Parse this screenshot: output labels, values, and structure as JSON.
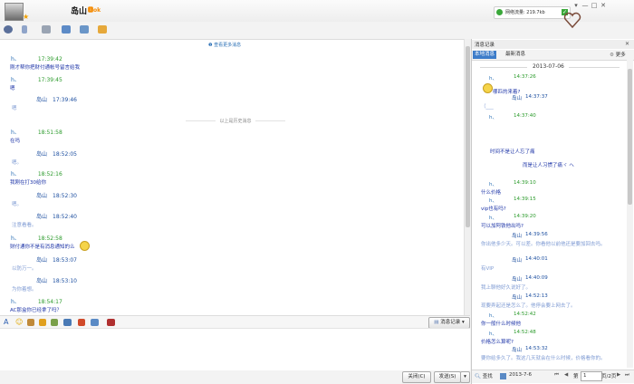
{
  "header": {
    "contact_name": "岛山",
    "name_badge": "🅰ok",
    "traffic_label": "网络流量: 219.7kb",
    "window_controls": [
      "▾",
      "—",
      "□",
      "✕"
    ]
  },
  "toolbar": {
    "icons": [
      "status-icon",
      "mic-icon",
      "folder-icon",
      "screen-share-icon",
      "remote-assist-icon",
      "apps-icon"
    ]
  },
  "chat": {
    "history_link": "查看更多消息",
    "history_divider": "以上是历史消息",
    "messages": [
      {
        "sender": "h、",
        "time": "17:39:42",
        "body": "刚才帮你把财付通帐号留言给我",
        "mine": true
      },
      {
        "sender": "h、",
        "time": "17:39:45",
        "body": "嗯",
        "mine": true
      },
      {
        "sender": "岛山",
        "time": "17:39:46",
        "body": "嗯",
        "mine": false
      },
      {
        "sender": "h、",
        "time": "18:51:58",
        "body": "在吗",
        "mine": true
      },
      {
        "sender": "岛山",
        "time": "18:52:05",
        "body": "嗯。",
        "mine": false
      },
      {
        "sender": "h、",
        "time": "18:52:16",
        "body": "我刚在打30给你",
        "mine": true
      },
      {
        "sender": "岛山",
        "time": "18:52:30",
        "body": "嗯。",
        "mine": false
      },
      {
        "sender": "岛山",
        "time": "18:52:40",
        "body": "注意看看。",
        "mine": false
      },
      {
        "sender": "h、",
        "time": "18:52:58",
        "body": "财付通你不是有消息通知的么",
        "mine": true
      },
      {
        "sender": "岛山",
        "time": "18:53:07",
        "body": "以防万一。",
        "mine": false
      },
      {
        "sender": "岛山",
        "time": "18:53:10",
        "body": "为你着想。",
        "mine": false
      },
      {
        "sender": "h、",
        "time": "18:54:17",
        "body": "AC那盒你已经拿了吗？",
        "mine": true
      }
    ]
  },
  "input": {
    "history_button": "消息记录",
    "close_button": "关闭(C)",
    "send_button": "发送(S)"
  },
  "history_panel": {
    "title": "消息记录",
    "tab_local": "本地消息",
    "tab_recent": "最新消息",
    "more": "更多",
    "date": "2013-07-06",
    "entries": [
      {
        "sender": "h、",
        "time": "14:37:26",
        "body": "哪匹的来着?",
        "mine": true
      },
      {
        "sender": "岛山",
        "time": "14:37:37",
        "body": "（___",
        "mine": false
      },
      {
        "sender": "h、",
        "time": "14:37:40",
        "body": "",
        "mine": true
      },
      {
        "sender": "",
        "time": "",
        "body": "时间不是让人忘了痛",
        "mine": true
      },
      {
        "sender": "",
        "time": "",
        "body": "而是让人习惯了痛ヾ ヘ",
        "mine": true
      },
      {
        "sender": "h、",
        "time": "14:39:10",
        "body": "什么价格",
        "mine": true
      },
      {
        "sender": "h、",
        "time": "14:39:15",
        "body": "vip也有吗?",
        "mine": true
      },
      {
        "sender": "h、",
        "time": "14:39:20",
        "body": "可以加阿铁他出吗?",
        "mine": true
      },
      {
        "sender": "岛山",
        "time": "14:39:56",
        "body": "你出他多少天。可以差。你看他以前他还是要加回去吗。",
        "mine": false
      },
      {
        "sender": "岛山",
        "time": "14:40:01",
        "body": "有VIP",
        "mine": false
      },
      {
        "sender": "岛山",
        "time": "14:40:09",
        "body": "我上聊他好久说好了。",
        "mine": false
      },
      {
        "sender": "岛山",
        "time": "14:52:13",
        "body": "现要弄起还是怎么了。他停会要上网去了。",
        "mine": false
      },
      {
        "sender": "h、",
        "time": "14:52:42",
        "body": "你一般什么时候他",
        "mine": true
      },
      {
        "sender": "h、",
        "time": "14:52:48",
        "body": "价格怎么算呢?",
        "mine": true
      },
      {
        "sender": "岛山",
        "time": "14:53:32",
        "body": "要你给多久了。我这几天就会在什么时候，价格看你的。",
        "mine": false
      }
    ],
    "footer": {
      "search": "查找",
      "date_picker": "2013-7-6",
      "page_prefix": "第",
      "page_value": "1",
      "page_suffix": "页/2页"
    }
  }
}
